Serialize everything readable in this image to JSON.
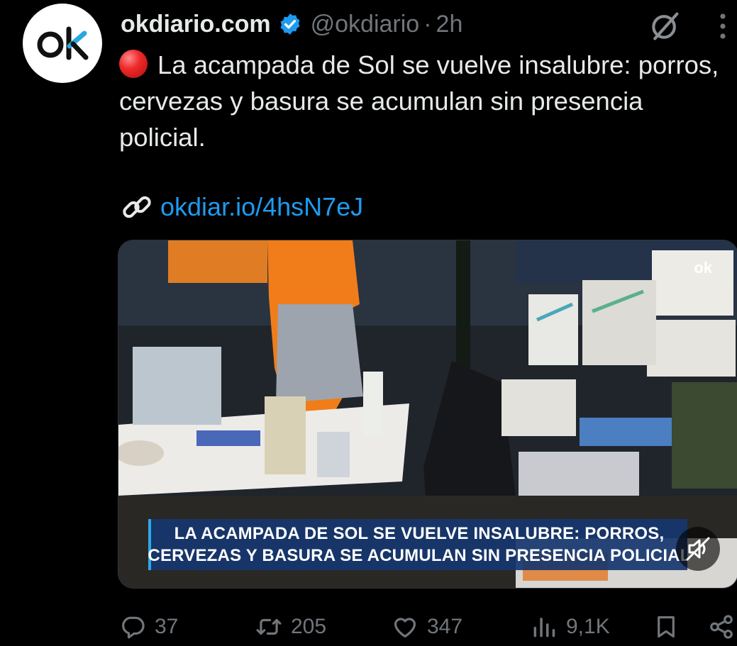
{
  "author": {
    "display_name": "okdiario.com",
    "handle": "@okdiario",
    "separator": "·",
    "time": "2h",
    "verified": true,
    "avatar_icon": "okdiario-logo"
  },
  "tweet": {
    "text": "La acampada de Sol se vuelve insalubre: porros, cervezas y basura se acumulan sin presencia policial.",
    "leading_emoji": "red-circle",
    "link_text": "okdiar.io/4hsN7eJ"
  },
  "media": {
    "watermark": "ok",
    "caption_line1": "LA ACAMPADA DE SOL SE VUELVE INSALUBRE: PORROS,",
    "caption_line2": "CERVEZAS Y BASURA SE ACUMULAN SIN PRESENCIA POLICIAL",
    "muted": true
  },
  "metrics": {
    "replies": "37",
    "retweets": "205",
    "likes": "347",
    "views": "9,1K"
  },
  "colors": {
    "background": "#000000",
    "text_primary": "#e7e9ea",
    "text_secondary": "#71767b",
    "link": "#1d9bf0",
    "verified_badge": "#1d9bf0",
    "caption_bg": "#16366e"
  },
  "icons": {
    "verified": "verified-badge-icon",
    "grok": "grok-icon",
    "more": "more-vertical-icon",
    "link": "link-icon",
    "mute": "speaker-muted-icon",
    "reply": "reply-icon",
    "retweet": "retweet-icon",
    "like": "heart-icon",
    "views": "views-bar-chart-icon",
    "bookmark": "bookmark-icon",
    "share": "share-icon"
  }
}
